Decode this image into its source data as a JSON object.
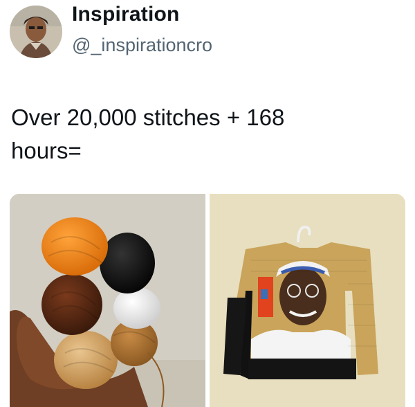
{
  "author": {
    "display_name": "Inspiration",
    "handle": "@_inspirationcro",
    "avatar_icon": "profile-photo"
  },
  "tweet": {
    "text": "Over 20,000 stitches + 168\nhours="
  },
  "media": [
    {
      "name": "yarn-balls-photo",
      "description_icon": "yarn-icon"
    },
    {
      "name": "crochet-sweater-photo",
      "description_icon": "sweater-icon"
    }
  ],
  "colors": {
    "text": "#0f1419",
    "secondary_text": "#536471",
    "yarn_orange": "#f28b1c",
    "yarn_black": "#151515",
    "yarn_brown": "#5a2a14",
    "yarn_white": "#f2f2f2",
    "yarn_tan": "#c99a5b",
    "sweater_gold": "#c9a45a"
  }
}
